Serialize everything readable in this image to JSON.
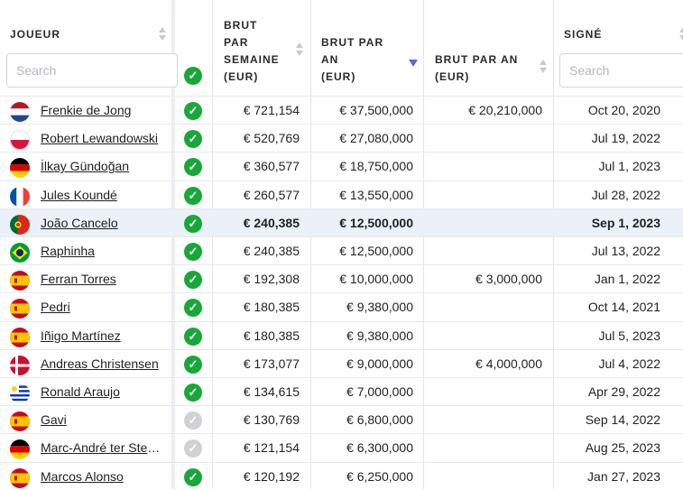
{
  "headers": {
    "player": "JOUEUR",
    "weekly": [
      "BRUT",
      "PAR",
      "SEMAINE",
      "(EUR)"
    ],
    "yearly": [
      "BRUT PAR",
      "AN",
      "(EUR)"
    ],
    "yearly2": [
      "BRUT PAR AN",
      "(EUR)"
    ],
    "signed": "SIGNÉ"
  },
  "search": {
    "player_placeholder": "Search",
    "signed_placeholder": "Search"
  },
  "colors": {
    "check_on": "#18a83a",
    "check_off": "#cfd1d4",
    "highlight": "#eaf1f9",
    "sort_active": "#6b63d1"
  },
  "rows": [
    {
      "flag": "netherlands",
      "name": "Frenkie de Jong",
      "check": true,
      "weekly": "€ 721,154",
      "yearly": "€ 37,500,000",
      "yearly2": "€ 20,210,000",
      "signed": "Oct 20, 2020"
    },
    {
      "flag": "poland",
      "name": "Robert Lewandowski",
      "check": true,
      "weekly": "€ 520,769",
      "yearly": "€ 27,080,000",
      "yearly2": "",
      "signed": "Jul 19, 2022"
    },
    {
      "flag": "germany",
      "name": "İlkay Gündoğan",
      "check": true,
      "weekly": "€ 360,577",
      "yearly": "€ 18,750,000",
      "yearly2": "",
      "signed": "Jul 1, 2023"
    },
    {
      "flag": "france",
      "name": "Jules Koundé",
      "check": true,
      "weekly": "€ 260,577",
      "yearly": "€ 13,550,000",
      "yearly2": "",
      "signed": "Jul 28, 2022"
    },
    {
      "flag": "portugal",
      "name": "João Cancelo",
      "check": true,
      "weekly": "€ 240,385",
      "yearly": "€ 12,500,000",
      "yearly2": "",
      "signed": "Sep 1, 2023",
      "highlight": true
    },
    {
      "flag": "brazil",
      "name": "Raphinha",
      "check": true,
      "weekly": "€ 240,385",
      "yearly": "€ 12,500,000",
      "yearly2": "",
      "signed": "Jul 13, 2022"
    },
    {
      "flag": "spain",
      "name": "Ferran Torres",
      "check": true,
      "weekly": "€ 192,308",
      "yearly": "€ 10,000,000",
      "yearly2": "€ 3,000,000",
      "signed": "Jan 1, 2022"
    },
    {
      "flag": "spain",
      "name": "Pedri",
      "check": true,
      "weekly": "€ 180,385",
      "yearly": "€ 9,380,000",
      "yearly2": "",
      "signed": "Oct 14, 2021"
    },
    {
      "flag": "spain",
      "name": "Iñigo Martínez",
      "check": true,
      "weekly": "€ 180,385",
      "yearly": "€ 9,380,000",
      "yearly2": "",
      "signed": "Jul 5, 2023"
    },
    {
      "flag": "denmark",
      "name": "Andreas Christensen",
      "check": true,
      "weekly": "€ 173,077",
      "yearly": "€ 9,000,000",
      "yearly2": "€ 4,000,000",
      "signed": "Jul 4, 2022"
    },
    {
      "flag": "uruguay",
      "name": "Ronald Araujo",
      "check": true,
      "weekly": "€ 134,615",
      "yearly": "€ 7,000,000",
      "yearly2": "",
      "signed": "Apr 29, 2022"
    },
    {
      "flag": "spain",
      "name": "Gavi",
      "check": false,
      "weekly": "€ 130,769",
      "yearly": "€ 6,800,000",
      "yearly2": "",
      "signed": "Sep 14, 2022"
    },
    {
      "flag": "germany",
      "name": "Marc-André ter Stegen",
      "check": false,
      "weekly": "€ 121,154",
      "yearly": "€ 6,300,000",
      "yearly2": "",
      "signed": "Aug 25, 2023"
    },
    {
      "flag": "spain",
      "name": "Marcos Alonso",
      "check": true,
      "weekly": "€ 120,192",
      "yearly": "€ 6,250,000",
      "yearly2": "",
      "signed": "Jan 27, 2023"
    }
  ]
}
